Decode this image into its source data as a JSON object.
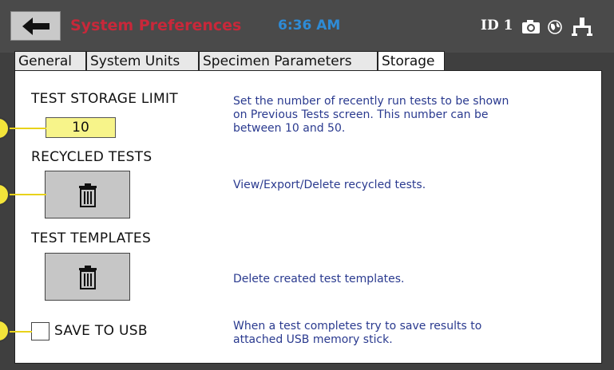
{
  "header": {
    "title": "System Preferences",
    "time": "6:36 AM",
    "id_label": "ID 1",
    "icons": [
      "back-arrow-icon",
      "camera-icon",
      "globe-icon",
      "usb-icon"
    ]
  },
  "tabs": [
    {
      "label": "General",
      "active": false
    },
    {
      "label": "System Units",
      "active": false
    },
    {
      "label": "Specimen Parameters",
      "active": false
    },
    {
      "label": "Storage",
      "active": true
    }
  ],
  "storage": {
    "test_storage_limit": {
      "label": "TEST STORAGE LIMIT",
      "value": "10",
      "description_lines": [
        "Set the number of recently run tests to be shown",
        "on Previous Tests screen. This number can be",
        "between 10 and 50."
      ]
    },
    "recycled_tests": {
      "label": "RECYCLED TESTS",
      "description": "View/Export/Delete recycled tests.",
      "button_icon": "trash-icon"
    },
    "test_templates": {
      "label": "TEST TEMPLATES",
      "description": "Delete created test templates.",
      "button_icon": "trash-icon"
    },
    "save_to_usb": {
      "label": "SAVE TO USB",
      "checked": false,
      "description_lines": [
        "When a test completes try to save results to",
        "attached USB memory stick."
      ]
    }
  },
  "colors": {
    "title_red": "#c8283a",
    "time_blue": "#2e8bd6",
    "description_blue": "#2a3a8f",
    "input_yellow": "#f7f48a",
    "callout_yellow": "#f3e43a"
  }
}
